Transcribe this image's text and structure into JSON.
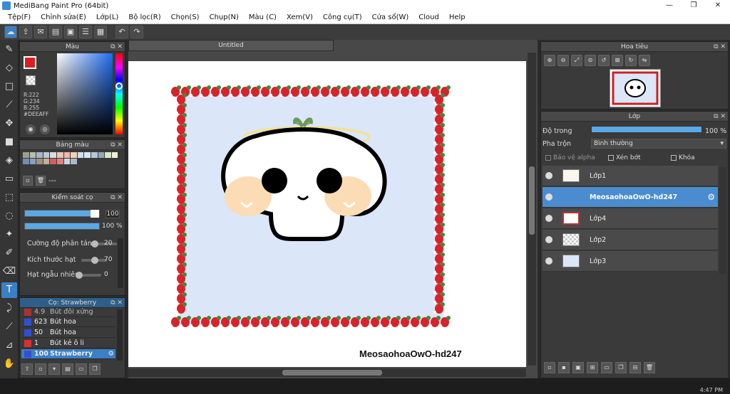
{
  "window": {
    "title": "MediBang Paint Pro (64bit)",
    "min_icon": "—",
    "max_icon": "❐",
    "close_icon": "✕"
  },
  "menu": [
    "Tệp(F)",
    "Chỉnh sửa(E)",
    "Lớp(L)",
    "Bộ lọc(R)",
    "Chọn(S)",
    "Chụp(N)",
    "Màu (C)",
    "Xem(V)",
    "Công cụ(T)",
    "Cửa sổ(W)",
    "Cloud",
    "Help"
  ],
  "toolbar": {
    "icons": [
      "cloud-icon",
      "upload-icon",
      "comment-icon",
      "document-icon",
      "copy-icon",
      "list-icon",
      "grid-icon",
      "undo-icon",
      "redo-icon"
    ],
    "undo_glyph": "↶",
    "redo_glyph": "↷"
  },
  "tools": [
    "brush-icon",
    "eraser-icon",
    "rectangle-icon",
    "pen-icon",
    "move-icon",
    "fill-icon",
    "bucket-icon",
    "gradient-icon",
    "select-rect-icon",
    "lasso-icon",
    "magic-wand-icon",
    "select-pen-icon",
    "select-eraser-icon",
    "text-icon",
    "operation-icon",
    "eyedropper-icon",
    "dropper-icon",
    "hand-icon"
  ],
  "color_panel": {
    "title": "Màu",
    "fg": "#dc1e1e",
    "r": "R:222",
    "g": "G:234",
    "b": "B:255",
    "hex": "#DEEAFF"
  },
  "palette_panel": {
    "title": "Bảng màu",
    "dashes": "---",
    "colors": [
      "#9aa08f",
      "#b6c0a8",
      "#a8b4c8",
      "#bfc8d0",
      "#d7dce0",
      "#e4c8b8",
      "#f0b8a8",
      "#f6d0b0",
      "#cfe0f0",
      "#d8e8f8",
      "#b0c8d8",
      "#90a8b8",
      "#d8e8c8",
      "#f0f0d8",
      "#7090b0",
      "#88a0c0",
      "#a09080",
      "#c0b0a0",
      "#d06060",
      "#e08080",
      "#c8d8e8",
      "#a8b8c8"
    ]
  },
  "brush_control": {
    "title": "Kiểm soát cọ",
    "size": "100",
    "opacity": "100 %",
    "scatter_label": "Cường độ phân tán",
    "scatter_value": "20",
    "dot_label": "Kích thước hạt",
    "dot_value": "70",
    "random_label": "Hạt ngẫu nhiên",
    "random_value": "0"
  },
  "brush_list": {
    "title": "Cọ: Strawberry",
    "items": [
      {
        "size": "4.9",
        "name": "Bút đôi xứng",
        "color": "#dc3030"
      },
      {
        "size": "623",
        "name": "Bút hoa",
        "color": "#3050d0"
      },
      {
        "size": "50",
        "name": "Bút hoa",
        "color": "#3050d0"
      },
      {
        "size": "1",
        "name": "Bút kẻ ô li",
        "color": "#dc3030"
      },
      {
        "size": "100",
        "name": "Strawberry",
        "color": "#3050d0"
      }
    ]
  },
  "canvas": {
    "tab": "Untitled",
    "watermark": "MeosaohoaOwO-hd247",
    "bg": "#dbe6f8"
  },
  "navigator": {
    "title": "Hoa tiêu"
  },
  "layers": {
    "title": "Lớp",
    "opacity_label": "Độ trong",
    "opacity_value": "100 %",
    "blend_label": "Pha trộn",
    "blend_value": "Bình thường",
    "protect_alpha": "Bảo vệ alpha",
    "clip": "Xén bớt",
    "lock": "Khóa",
    "items": [
      {
        "name": "Lớp1",
        "selected": false
      },
      {
        "name": "MeosaohoaOwO-hd247",
        "selected": true
      },
      {
        "name": "Lớp4",
        "selected": false
      },
      {
        "name": "Lớp2",
        "selected": false
      },
      {
        "name": "Lớp3",
        "selected": false
      }
    ]
  },
  "status": {
    "clock": "4:47 PM"
  }
}
